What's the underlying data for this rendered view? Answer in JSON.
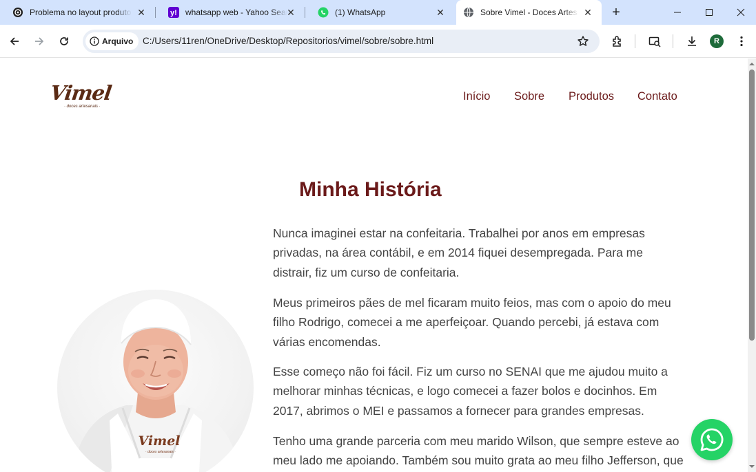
{
  "browser": {
    "tabs": [
      {
        "title": "Problema no layout produtos",
        "favicon": "openai-icon"
      },
      {
        "title": "whatsapp web - Yahoo Search",
        "favicon": "yahoo-icon"
      },
      {
        "title": "(1) WhatsApp",
        "favicon": "whatsapp-icon"
      },
      {
        "title": "Sobre Vimel - Doces Artesanais",
        "favicon": "globe-icon",
        "active": true
      }
    ],
    "security_chip": "Arquivo",
    "url": "C:/Users/11ren/OneDrive/Desktop/Repositorios/vimel/sobre/sobre.html",
    "profile_initial": "R"
  },
  "site": {
    "logo_text": "Vimel",
    "logo_subtext": "· doces artesanais ·",
    "nav": [
      "Início",
      "Sobre",
      "Produtos",
      "Contato"
    ],
    "heading": "Minha História",
    "paragraphs": [
      [
        "Nunca imaginei estar na confeitaria. Trabalhei por anos em empresas",
        "privadas, na área contábil, e em 2014 fiquei desempregada. Para me",
        "distrair, fiz um curso de confeitaria."
      ],
      [
        "Meus primeiros pães de mel ficaram muito feios, mas com o apoio do meu",
        "filho Rodrigo, comecei a me aperfeiçoar. Quando percebi, já estava com",
        "várias encomendas."
      ],
      [
        "Esse começo não foi fácil. Fiz um curso no SENAI que me ajudou muito a",
        "melhorar minhas técnicas, e logo comecei a fazer bolos e docinhos. Em",
        "2017, abrimos o MEI e passamos a fornecer para grandes empresas."
      ],
      [
        "Tenho uma grande parceria com meu marido Wilson, que sempre esteve ao",
        "meu lado me apoiando. Também sou muito grata ao meu filho Jefferson, que"
      ]
    ],
    "photo_apron_text": "Vimel",
    "photo_apron_subtext": "· doces artesanais ·"
  },
  "colors": {
    "brand": "#6b1a1a",
    "whatsapp": "#25d366",
    "tabstrip": "#d3e3fd"
  }
}
